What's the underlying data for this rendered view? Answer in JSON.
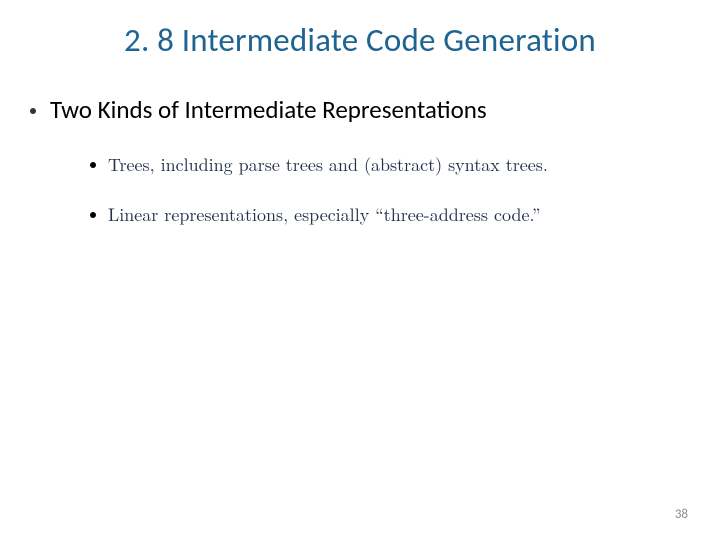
{
  "slide": {
    "title": "2. 8 Intermediate Code Generation",
    "bullet1": "Two Kinds of Intermediate Representations",
    "sub_bullets": {
      "item0": "Trees, including parse trees and (abstract) syntax trees.",
      "item1": "Linear representations, especially “three-address code.”"
    },
    "page_number": "38"
  }
}
